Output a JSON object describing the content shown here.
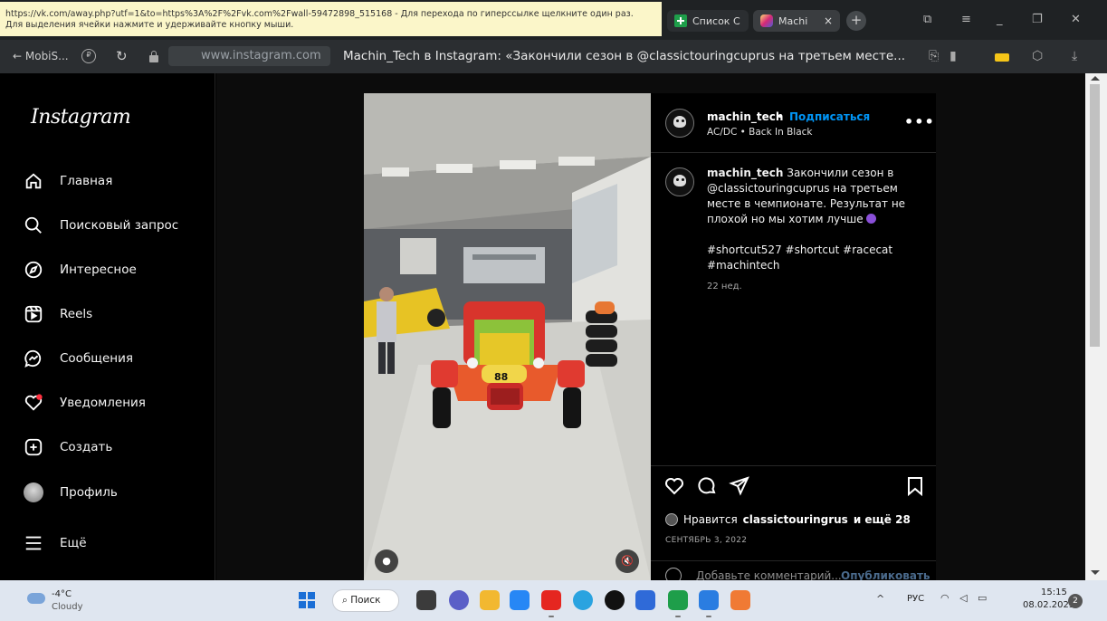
{
  "tooltip": {
    "line1": "https://vk.com/away.php?utf=1&to=https%3A%2F%2Fvk.com%2Fwall-59472898_515168 - Для перехода по гиперссылке щелкните один раз.",
    "line2": "Для выделения ячейки нажмите и удерживайте кнопку мыши."
  },
  "tabs": [
    {
      "label": "Список С",
      "icon": "sheets-icon"
    },
    {
      "label": "Machi",
      "icon": "instagram-icon",
      "active": true
    }
  ],
  "tab_close": "×",
  "new_tab": "+",
  "address_bar": {
    "back_label": "← MobiS...",
    "domain": "www.instagram.com",
    "page_title": "Machin_Tech в Instagram: «Закончили сезон в @classictouringcuprus на третьем месте..."
  },
  "sidebar": {
    "logo": "Instagram",
    "items": [
      {
        "label": "Главная",
        "icon": "home-icon"
      },
      {
        "label": "Поисковый запрос",
        "icon": "search-icon"
      },
      {
        "label": "Интересное",
        "icon": "compass-icon"
      },
      {
        "label": "Reels",
        "icon": "reels-icon"
      },
      {
        "label": "Сообщения",
        "icon": "messenger-icon"
      },
      {
        "label": "Уведомления",
        "icon": "heart-icon"
      },
      {
        "label": "Создать",
        "icon": "plus-square-icon"
      },
      {
        "label": "Профиль",
        "icon": "avatar"
      },
      {
        "label": "Ещё",
        "icon": "menu-icon"
      }
    ]
  },
  "post": {
    "username": "machin_tech",
    "dot": "•",
    "follow": "Подписаться",
    "audio": "AC/DC • Back In Black",
    "more": "•••",
    "caption_text": "Закончили сезон в @classictouringcuprus на третьем месте в чемпионате. Результат не плохой но мы хотим лучше",
    "hashtags": "#shortcut527 #shortcut #racecat #machintech",
    "time_ago": "22 нед.",
    "likes_prefix": "Нравится",
    "likes_user": "classictouringrus",
    "likes_suffix": "и ещё 28",
    "date": "СЕНТЯБРЬ 3, 2022",
    "comment_placeholder": "Добавьте комментарий...",
    "comment_post": "Опубликовать",
    "car_number": "88"
  },
  "taskbar": {
    "weather_temp": "-4°C",
    "weather_desc": "Cloudy",
    "search_label": "Поиск",
    "tray_caret": "^",
    "lang": "РУС",
    "time": "15:15",
    "date": "08.02.2023",
    "notif_count": "2",
    "apps": [
      {
        "name": "file-explorer-icon",
        "color": "#3b3b3b"
      },
      {
        "name": "chat-icon",
        "color": "#5b5fc7"
      },
      {
        "name": "folder-icon",
        "color": "#f2b830"
      },
      {
        "name": "vk-icon",
        "color": "#2787f5"
      },
      {
        "name": "yandex-icon",
        "color": "#e52620"
      },
      {
        "name": "telegram-icon",
        "color": "#2aa3e0"
      },
      {
        "name": "tiktok-icon",
        "color": "#111111"
      },
      {
        "name": "vpn-icon",
        "color": "#2f6ad8"
      },
      {
        "name": "sheets-app-icon",
        "color": "#1e9e4a"
      },
      {
        "name": "docs-app-icon",
        "color": "#2a7de1"
      },
      {
        "name": "photo-app-icon",
        "color": "#f07a34"
      }
    ]
  },
  "colors": {
    "follow_blue": "#0095f6",
    "browser_chrome": "#2b2e31",
    "instagram_bg": "#000000"
  }
}
